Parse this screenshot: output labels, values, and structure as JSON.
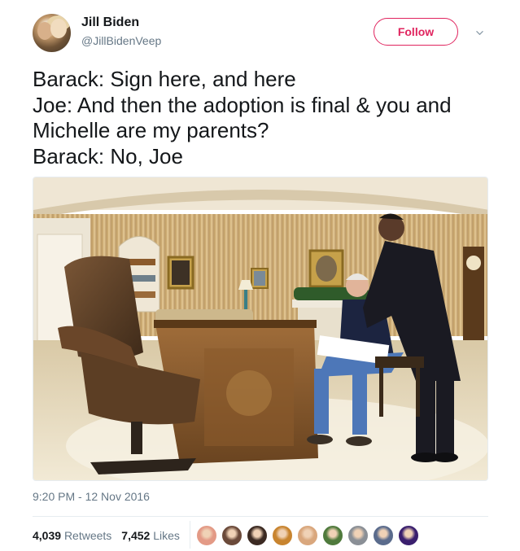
{
  "author": {
    "name": "Jill Biden",
    "handle": "@JillBidenVeep"
  },
  "follow_button": {
    "label": "Follow"
  },
  "more_menu": {
    "icon": "chevron-down-icon"
  },
  "tweet": {
    "lines": [
      "Barack: Sign here, and here",
      "Joe: And then the adoption is final & you and",
      "Michelle are my parents?",
      "Barack: No, Joe"
    ]
  },
  "timestamp": "9:20 PM - 12 Nov 2016",
  "stats": {
    "retweets_count": "4,039",
    "retweets_label": "Retweets",
    "likes_count": "7,452",
    "likes_label": "Likes"
  },
  "colors": {
    "accent": "#e0245e",
    "secondary_text": "#657786",
    "primary_text": "#14171a"
  },
  "liker_avatars": [
    {
      "color": "#e39a86"
    },
    {
      "color": "#6b4a3a"
    },
    {
      "color": "#3b2a22"
    },
    {
      "color": "#c8842f"
    },
    {
      "color": "#d9a77d"
    },
    {
      "color": "#4f7a3c"
    },
    {
      "color": "#8a8f96"
    },
    {
      "color": "#5a6b8c"
    },
    {
      "color": "#3a1f6e"
    }
  ]
}
